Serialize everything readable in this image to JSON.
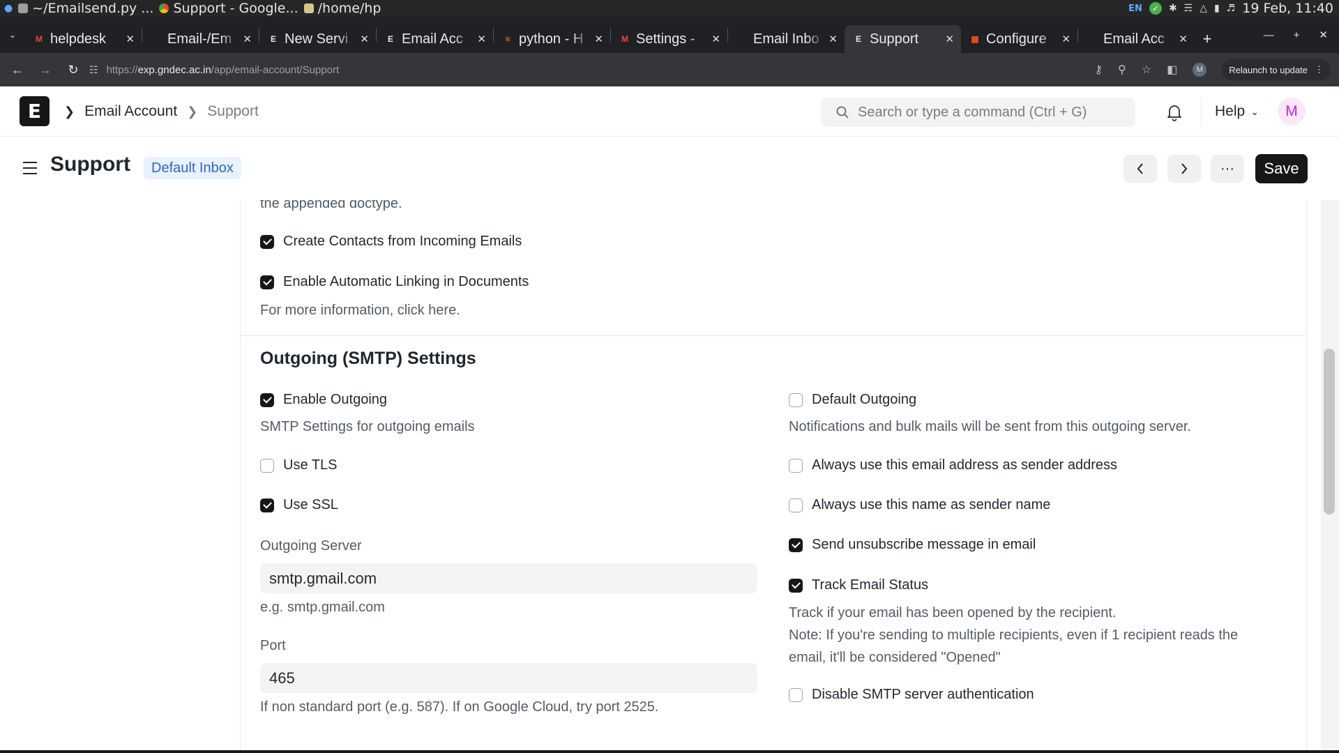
{
  "os_bar": {
    "items": [
      {
        "label": "~/Emailsend.py ...",
        "icon": "editor-icon"
      },
      {
        "label": "Support - Google...",
        "icon": "chrome-icon"
      },
      {
        "label": "/home/hp",
        "icon": "folder-icon"
      }
    ],
    "lang": "EN",
    "datetime": "19 Feb, 11:40"
  },
  "browser": {
    "tabs": [
      {
        "label": "helpdesk",
        "fav": "M",
        "fav_color": "#ea4335"
      },
      {
        "label": "Email-/Em",
        "fav": "",
        "fav_color": "#aaaaaa"
      },
      {
        "label": "New Servi",
        "fav": "E",
        "fav_color": "#e8eaed"
      },
      {
        "label": "Email Acc",
        "fav": "E",
        "fav_color": "#e8eaed"
      },
      {
        "label": "python - H",
        "fav": "≡",
        "fav_color": "#f48024"
      },
      {
        "label": "Settings -",
        "fav": "M",
        "fav_color": "#ea4335"
      },
      {
        "label": "Email Inbo",
        "fav": "",
        "fav_color": "#aaaaaa"
      },
      {
        "label": "Support",
        "fav": "E",
        "fav_color": "#e8eaed",
        "active": true
      },
      {
        "label": "Configure",
        "fav": "▦",
        "fav_color": "#f25022"
      },
      {
        "label": "Email Acc",
        "fav": "",
        "fav_color": "#aaaaaa"
      }
    ],
    "url_scheme": "https://",
    "url_host": "exp.gndec.ac.in",
    "url_path": "/app/email-account/Support",
    "profile_initial": "M",
    "relaunch_label": "Relaunch to update"
  },
  "navbar": {
    "logo_letter": "E",
    "breadcrumb": [
      "Email Account",
      "Support"
    ],
    "search_placeholder": "Search or type a command (Ctrl + G)",
    "help_label": "Help",
    "user_initial": "M"
  },
  "page": {
    "title": "Support",
    "badge": "Default Inbox",
    "more_label": "···",
    "save_label": "Save"
  },
  "form": {
    "top_fragment": "the appended doctype.",
    "create_contacts": {
      "label": "Create Contacts from Incoming Emails",
      "checked": true
    },
    "auto_linking": {
      "label": "Enable Automatic Linking in Documents",
      "checked": true
    },
    "auto_linking_help": "For more information, click here.",
    "smtp_title": "Outgoing (SMTP) Settings",
    "enable_outgoing": {
      "label": "Enable Outgoing",
      "checked": true
    },
    "enable_outgoing_help": "SMTP Settings for outgoing emails",
    "use_tls": {
      "label": "Use TLS",
      "checked": false
    },
    "use_ssl": {
      "label": "Use SSL",
      "checked": true
    },
    "outgoing_server_label": "Outgoing Server",
    "outgoing_server_value": "smtp.gmail.com",
    "outgoing_server_help": "e.g. smtp.gmail.com",
    "port_label": "Port",
    "port_value": "465",
    "port_help": "If non standard port (e.g. 587). If on Google Cloud, try port 2525.",
    "default_outgoing": {
      "label": "Default Outgoing",
      "checked": false
    },
    "default_outgoing_help": "Notifications and bulk mails will be sent from this outgoing server.",
    "always_sender_address": {
      "label": "Always use this email address as sender address",
      "checked": false
    },
    "always_sender_name": {
      "label": "Always use this name as sender name",
      "checked": false
    },
    "send_unsubscribe": {
      "label": "Send unsubscribe message in email",
      "checked": true
    },
    "track_status": {
      "label": "Track Email Status",
      "checked": true
    },
    "track_help_1": "Track if your email has been opened by the recipient.",
    "track_help_2": "Note: If you're sending to multiple recipients, even if 1 recipient reads the",
    "track_help_3": "email, it'll be considered \"Opened\"",
    "disable_auth": {
      "label": "Disable SMTP server authentication",
      "checked": false
    }
  },
  "colors": {
    "accent_dark": "#171717",
    "badge_bg": "#e8f1fc",
    "badge_text": "#2f67c4",
    "avatar_text": "#c026d3"
  }
}
